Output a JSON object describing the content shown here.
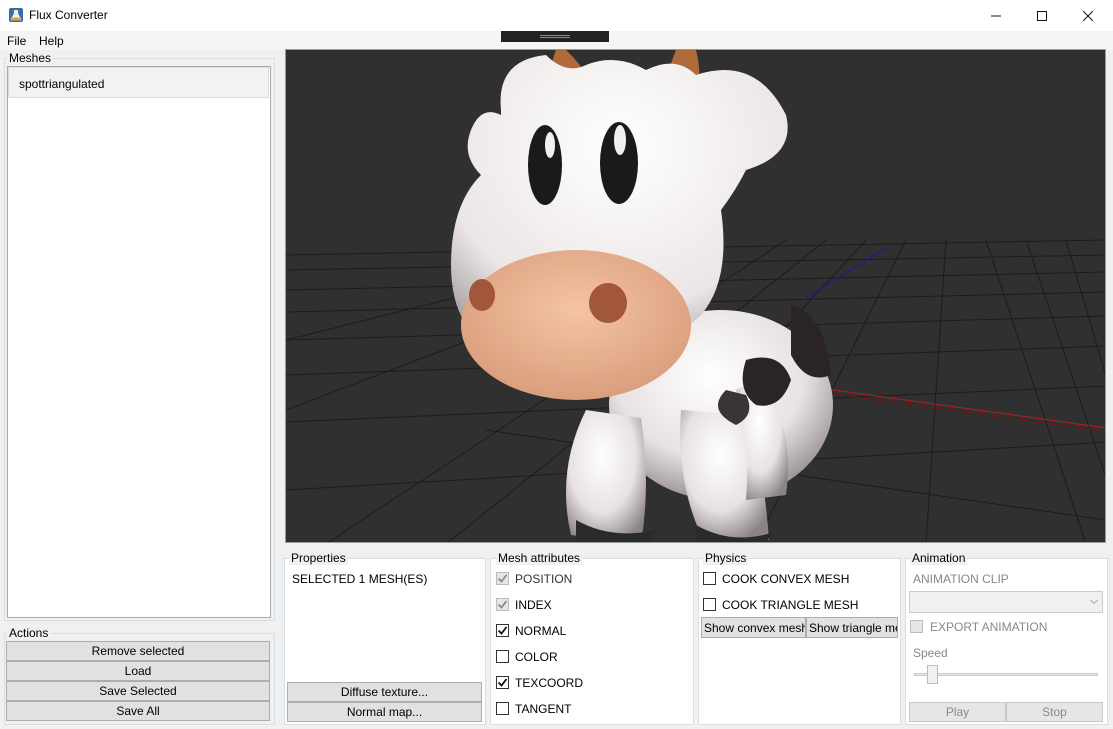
{
  "window": {
    "title": "Flux Converter",
    "icon": "flask-icon",
    "controls": [
      "minimize-icon",
      "maximize-icon",
      "close-icon"
    ]
  },
  "menu": {
    "items": [
      "File",
      "Help"
    ]
  },
  "meshes": {
    "label": "Meshes",
    "items": [
      "spottriangulated"
    ]
  },
  "actions": {
    "label": "Actions",
    "buttons": [
      "Remove selected",
      "Load",
      "Save Selected",
      "Save All"
    ]
  },
  "properties": {
    "label": "Properties",
    "selected_text": "SELECTED 1 MESH(ES)",
    "buttons": [
      "Diffuse texture...",
      "Normal map..."
    ]
  },
  "mesh_attributes": {
    "label": "Mesh attributes",
    "items": [
      {
        "label": "POSITION",
        "checked": true,
        "enabled": false
      },
      {
        "label": "INDEX",
        "checked": true,
        "enabled": false
      },
      {
        "label": "NORMAL",
        "checked": true,
        "enabled": true
      },
      {
        "label": "COLOR",
        "checked": false,
        "enabled": true
      },
      {
        "label": "TEXCOORD",
        "checked": true,
        "enabled": true
      },
      {
        "label": "TANGENT",
        "checked": false,
        "enabled": true
      }
    ]
  },
  "physics": {
    "label": "Physics",
    "options": [
      {
        "label": "COOK CONVEX MESH",
        "checked": false
      },
      {
        "label": "COOK TRIANGLE MESH",
        "checked": false
      }
    ],
    "buttons": [
      "Show convex mesh",
      "Show triangle me"
    ]
  },
  "animation": {
    "label": "Animation",
    "clip_label": "ANIMATION CLIP",
    "clip_value": "",
    "export_label": "EXPORT ANIMATION",
    "export_checked": false,
    "speed_label": "Speed",
    "speed_value": 0.1,
    "buttons": [
      "Play",
      "Stop"
    ]
  },
  "colors": {
    "viewport_bg": "#303030",
    "grid": "#1e1e1e",
    "axis_x": "#a02020",
    "axis_z": "#1a1a9a"
  }
}
